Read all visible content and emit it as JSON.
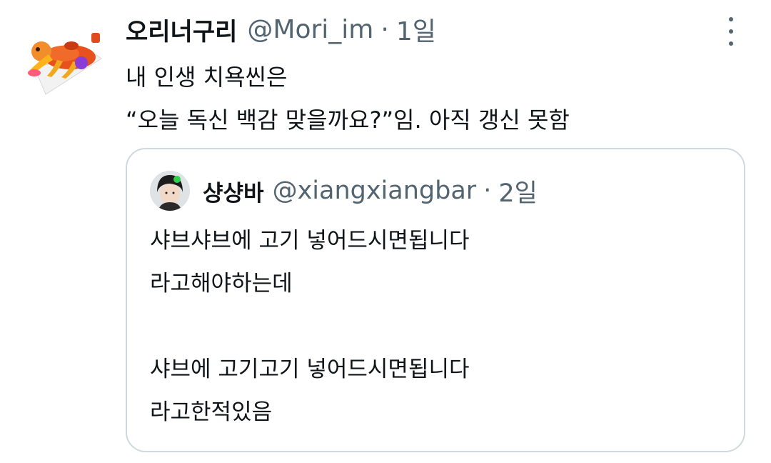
{
  "tweet": {
    "display_name": "오리너구리",
    "handle": "@Mori_im",
    "separator": "·",
    "time": "1일",
    "text_lines": [
      "내 인생 치욕씬은",
      "“오늘 독신 백감 맞을까요?”임. 아직 갱신 못함"
    ],
    "more_icon": "more-vertical-icon"
  },
  "quote": {
    "display_name": "샹샹바",
    "handle": "@xiangxiangbar",
    "separator": "·",
    "time": "2일",
    "text_lines": [
      "샤브샤브에 고기 넣어드시면됩니다",
      "라고해야하는데",
      "",
      "샤브에 고기고기 넣어드시면됩니다",
      "라고한적있음"
    ]
  },
  "colors": {
    "text": "#0f1419",
    "secondary": "#536471",
    "border": "#cfd9de",
    "background": "#ffffff"
  }
}
